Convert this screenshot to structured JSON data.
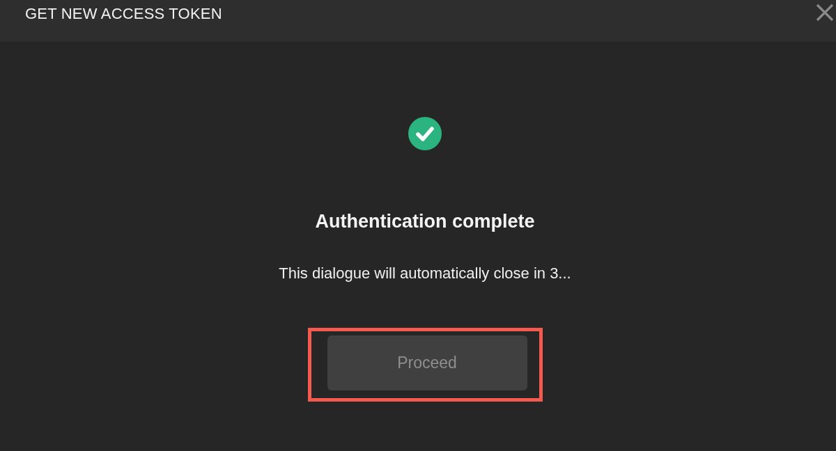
{
  "dialog": {
    "title": "GET NEW ACCESS TOKEN",
    "status": {
      "kind": "success",
      "heading": "Authentication complete",
      "message": "This dialogue will automatically close in 3..."
    },
    "buttons": [
      {
        "label": "Proceed",
        "disabled": true,
        "highlighted": true
      }
    ]
  }
}
